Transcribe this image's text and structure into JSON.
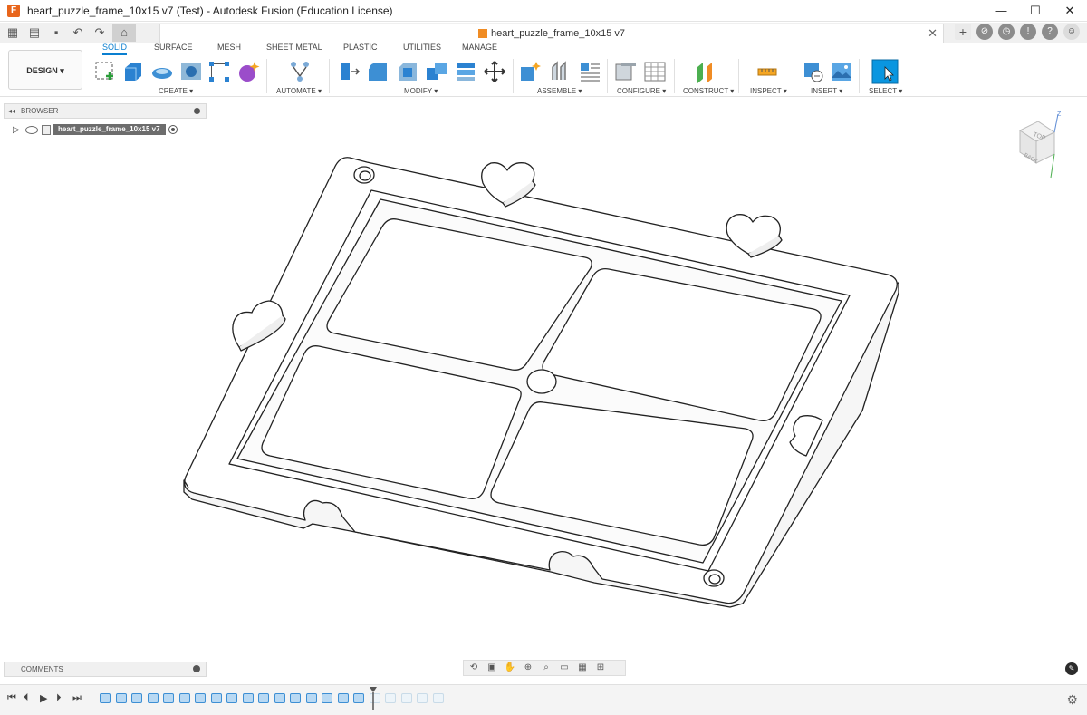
{
  "window": {
    "title": "heart_puzzle_frame_10x15 v7 (Test) - Autodesk Fusion (Education License)",
    "minimize": "—",
    "maximize": "☐",
    "close": "✕"
  },
  "document_tab": {
    "name": "heart_puzzle_frame_10x15 v7",
    "close": "✕",
    "add": "+"
  },
  "ribbon": {
    "workspace": "DESIGN",
    "tabs": [
      "SOLID",
      "SURFACE",
      "MESH",
      "SHEET METAL",
      "PLASTIC",
      "UTILITIES",
      "MANAGE"
    ],
    "active_tab": "SOLID",
    "groups": [
      "CREATE",
      "AUTOMATE",
      "MODIFY",
      "ASSEMBLE",
      "CONFIGURE",
      "CONSTRUCT",
      "INSPECT",
      "INSERT",
      "SELECT"
    ]
  },
  "browser": {
    "title": "BROWSER",
    "root_item": "heart_puzzle_frame_10x15 v7"
  },
  "comments": {
    "title": "COMMENTS"
  },
  "viewcube": {
    "top": "TOP",
    "back": "BACK",
    "z": "Z"
  },
  "colors": {
    "accent": "#0a7fd0",
    "brand": "#e8651b"
  }
}
